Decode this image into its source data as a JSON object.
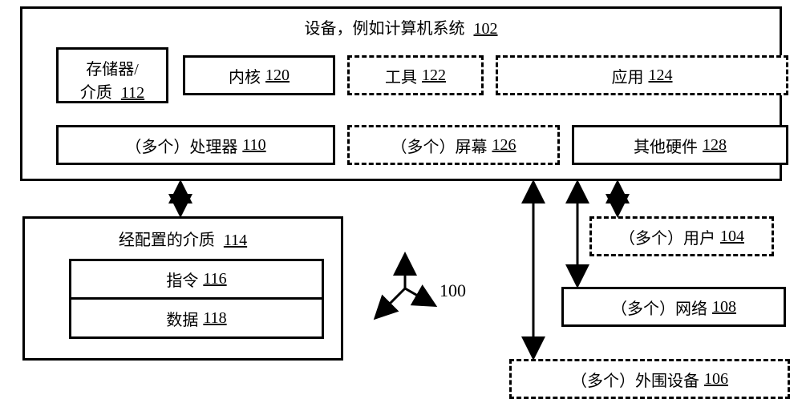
{
  "device": {
    "title": "设备，例如计算机系统",
    "num": "102"
  },
  "memory": {
    "line1": "存储器/",
    "line2": "介质",
    "num": "112"
  },
  "kernel": {
    "label": "内核",
    "num": "120"
  },
  "tools": {
    "label": "工具",
    "num": "122"
  },
  "apps": {
    "label": "应用",
    "num": "124"
  },
  "procs": {
    "label": "（多个）处理器",
    "num": "110"
  },
  "screens": {
    "label": "（多个）屏幕",
    "num": "126"
  },
  "hw": {
    "label": "其他硬件",
    "num": "128"
  },
  "medium": {
    "title": "经配置的介质",
    "num": "114"
  },
  "instr": {
    "label": "指令",
    "num": "116"
  },
  "data": {
    "label": "数据",
    "num": "118"
  },
  "users": {
    "label": "（多个）用户",
    "num": "104"
  },
  "nets": {
    "label": "（多个）网络",
    "num": "108"
  },
  "periph": {
    "label": "（多个）外围设备",
    "num": "106"
  },
  "compass": {
    "num": "100"
  }
}
